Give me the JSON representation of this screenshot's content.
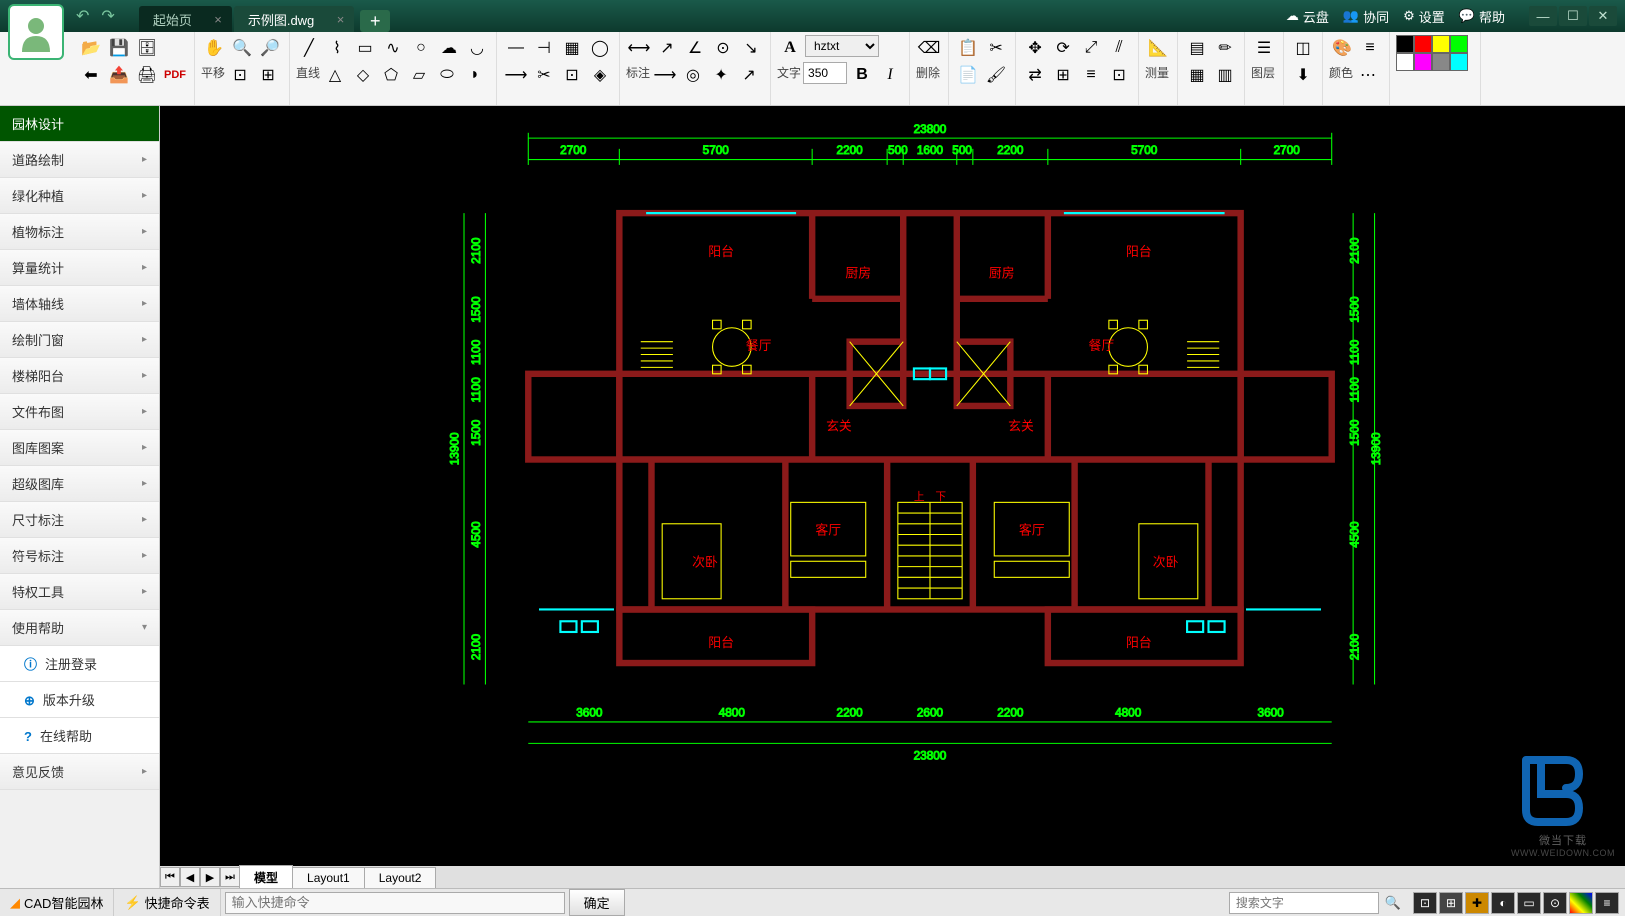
{
  "titlebar": {
    "tabs": [
      {
        "label": "起始页",
        "active": false
      },
      {
        "label": "示例图.dwg",
        "active": true
      }
    ],
    "right": {
      "cloud": "云盘",
      "collab": "协同",
      "settings": "设置",
      "help": "帮助"
    }
  },
  "ribbon": {
    "pan": "平移",
    "line": "直线",
    "dim": "标注",
    "text": "文字",
    "font_name": "hztxt",
    "font_size": "350",
    "delete": "删除",
    "measure": "测量",
    "layer": "图层",
    "color": "颜色"
  },
  "sidebar": {
    "items": [
      "园林设计",
      "道路绘制",
      "绿化种植",
      "植物标注",
      "算量统计",
      "墙体轴线",
      "绘制门窗",
      "楼梯阳台",
      "文件布图",
      "图库图案",
      "超级图库",
      "尺寸标注",
      "符号标注",
      "特权工具",
      "使用帮助"
    ],
    "sub": [
      "注册登录",
      "版本升级",
      "在线帮助"
    ],
    "feedback": "意见反馈"
  },
  "layout_tabs": [
    "模型",
    "Layout1",
    "Layout2"
  ],
  "status": {
    "app_name": "CAD智能园林",
    "shortcut": "快捷命令表",
    "cmd_placeholder": "输入快捷命令",
    "confirm": "确定",
    "search_placeholder": "搜索文字"
  },
  "floorplan": {
    "total_width": "23800",
    "top_dims": [
      "2700",
      "5700",
      "2200",
      "500",
      "1600",
      "500",
      "2200",
      "5700",
      "2700"
    ],
    "bottom_dims": [
      "3600",
      "4800",
      "2200",
      "2600",
      "2200",
      "4800",
      "3600"
    ],
    "left_dims": [
      "2100",
      "1500",
      "1100",
      "1100",
      "1500",
      "4500",
      "2100"
    ],
    "left_total": "13900",
    "right_dims": [
      "2100",
      "1500",
      "1100",
      "1100",
      "1500",
      "4500",
      "2100"
    ],
    "right_total": "13900",
    "rooms": {
      "balcony_tl": "阳台",
      "balcony_tr": "阳台",
      "kitchen_l": "厨房",
      "kitchen_r": "厨房",
      "dining_l": "餐厅",
      "dining_r": "餐厅",
      "entry_l": "玄关",
      "entry_r": "玄关",
      "living_l": "客厅",
      "living_r": "客厅",
      "bed_l": "次卧",
      "bed_r": "次卧",
      "balcony_bl": "阳台",
      "balcony_br": "阳台",
      "stair_up": "上",
      "stair_down": "下"
    }
  },
  "colors": [
    "#000000",
    "#ff0000",
    "#ffff00",
    "#00ff00",
    "#ffffff",
    "#ff00ff",
    "#808080",
    "#00ffff"
  ],
  "watermark": {
    "text": "微当下载",
    "url": "WWW.WEIDOWN.COM"
  }
}
